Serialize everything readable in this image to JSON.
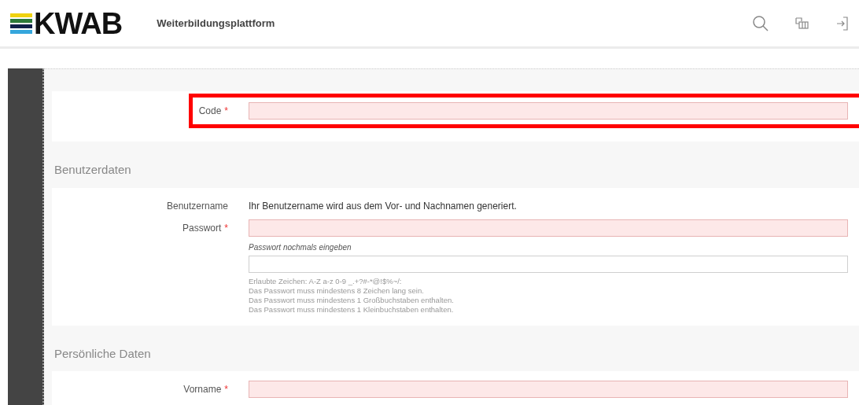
{
  "header": {
    "logo": "KWAB",
    "title": "Weiterbildungsplattform"
  },
  "code_section": {
    "fields": [
      {
        "kind": "input",
        "label": "Code",
        "required_mark": "*",
        "invalid": true,
        "highlighted": true
      }
    ]
  },
  "sections": [
    {
      "title": "Benutzerdaten",
      "fields": [
        {
          "kind": "text",
          "label": "Benutzername",
          "value": "Ihr Benutzername wird aus dem Vor- und Nachnamen generiert."
        },
        {
          "kind": "input",
          "label": "Passwort",
          "required_mark": "*",
          "invalid": true
        },
        {
          "kind": "repeat",
          "sublabel": "Passwort nochmals eingeben",
          "invalid": false,
          "hints": [
            "Erlaubte Zeichen: A-Z a-z 0-9 _.+?#-*@!$%~/:",
            "Das Passwort muss mindestens 8 Zeichen lang sein.",
            "Das Passwort muss mindestens 1 Großbuchstaben enthalten.",
            "Das Passwort muss mindestens 1 Kleinbuchstaben enthalten."
          ]
        }
      ]
    },
    {
      "title": "Persönliche Daten",
      "fields": [
        {
          "kind": "input",
          "label": "Vorname",
          "required_mark": "*",
          "invalid": true
        }
      ]
    }
  ]
}
